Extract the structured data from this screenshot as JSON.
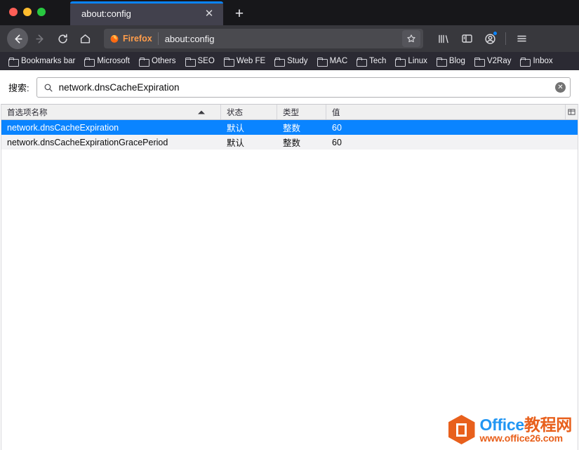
{
  "window": {
    "controls": [
      "close",
      "minimize",
      "maximize"
    ]
  },
  "tabs": {
    "active": {
      "title": "about:config",
      "close_label": "✕"
    },
    "new_tab_label": "+"
  },
  "toolbar": {
    "back_icon": "back-arrow-icon",
    "forward_icon": "forward-arrow-icon",
    "reload_icon": "reload-icon",
    "home_icon": "home-icon",
    "brand_label": "Firefox",
    "url": "about:config",
    "bookmark_icon": "star-icon",
    "library_icon": "library-icon",
    "sidebar_icon": "sidebar-icon",
    "account_icon": "account-icon",
    "menu_icon": "hamburger-menu-icon"
  },
  "bookmarks_bar": {
    "items": [
      {
        "label": "Bookmarks bar"
      },
      {
        "label": "Microsoft"
      },
      {
        "label": "Others"
      },
      {
        "label": "SEO"
      },
      {
        "label": "Web FE"
      },
      {
        "label": "Study"
      },
      {
        "label": "MAC"
      },
      {
        "label": "Tech"
      },
      {
        "label": "Linux"
      },
      {
        "label": "Blog"
      },
      {
        "label": "V2Ray"
      },
      {
        "label": "Inbox"
      }
    ]
  },
  "search": {
    "label": "搜索:",
    "value": "network.dnsCacheExpiration",
    "placeholder": "",
    "search_icon": "search-icon",
    "clear_icon": "clear-icon",
    "clear_label": "✕"
  },
  "table": {
    "columns": [
      {
        "key": "name",
        "label": "首选项名称",
        "sort": "asc"
      },
      {
        "key": "state",
        "label": "状态"
      },
      {
        "key": "type",
        "label": "类型"
      },
      {
        "key": "value",
        "label": "值"
      }
    ],
    "column_picker_icon": "column-picker-icon",
    "rows": [
      {
        "name": "network.dnsCacheExpiration",
        "state": "默认",
        "type": "整数",
        "value": "60",
        "selected": true
      },
      {
        "name": "network.dnsCacheExpirationGracePeriod",
        "state": "默认",
        "type": "整数",
        "value": "60",
        "selected": false
      }
    ]
  },
  "watermark": {
    "title_en": "Office",
    "title_cn": "教程网",
    "url": "www.office26.com"
  },
  "colors": {
    "accent_blue": "#0a84ff",
    "chrome_dark": "#38383d",
    "titlebar": "#17171a",
    "bookmarks_bg": "#2b2a33",
    "brand_orange": "#ff9d4b",
    "watermark_orange": "#e8601c",
    "watermark_blue": "#2196f3"
  }
}
